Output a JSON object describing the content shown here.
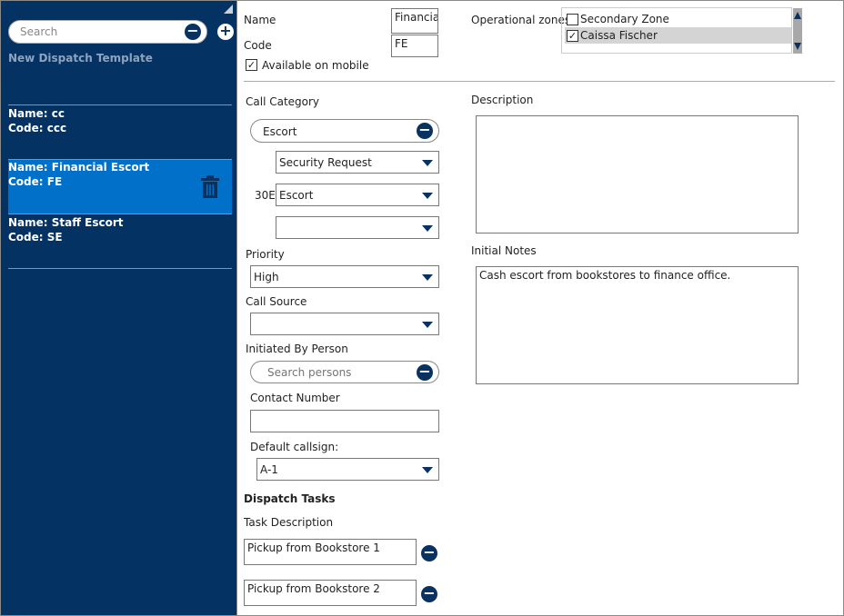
{
  "sidebar": {
    "search_placeholder": "Search",
    "new_template": "New Dispatch Template",
    "items": [
      {
        "name": "Name: cc",
        "code": "Code: ccc"
      },
      {
        "name": "Name: Financial Escort",
        "code": "Code: FE"
      },
      {
        "name": "Name: Staff Escort",
        "code": "Code: SE"
      }
    ]
  },
  "form": {
    "name_label": "Name",
    "name_value": "Financial",
    "code_label": "Code",
    "code_value": "FE",
    "mobile_label": "Available on mobile",
    "mobile_checked": true,
    "zones_label": "Operational zones:",
    "zones": [
      {
        "label": "Secondary Zone",
        "checked": false
      },
      {
        "label": "Caissa Fischer",
        "checked": true
      }
    ],
    "call_category_label": "Call Category",
    "call_category_value": "Escort",
    "sub1": "Security Request",
    "sub2_code": "30E",
    "sub2": "Escort",
    "sub3": "",
    "priority_label": "Priority",
    "priority_value": "High",
    "call_source_label": "Call Source",
    "call_source_value": "",
    "initiated_label": "Initiated By Person",
    "initiated_placeholder": "Search persons",
    "contact_label": "Contact Number",
    "contact_value": "",
    "callsign_label": "Default callsign:",
    "callsign_value": "A-1",
    "description_label": "Description",
    "description_value": "",
    "notes_label": "Initial Notes",
    "notes_value": "Cash escort from bookstores to finance office.",
    "tasks_heading": "Dispatch Tasks",
    "task_desc_label": "Task Description",
    "tasks": [
      "Pickup from Bookstore 1",
      "Pickup from Bookstore 2"
    ]
  },
  "colors": {
    "sidebar": "#033263",
    "selected": "#0070c8",
    "accent": "#0a3261"
  }
}
